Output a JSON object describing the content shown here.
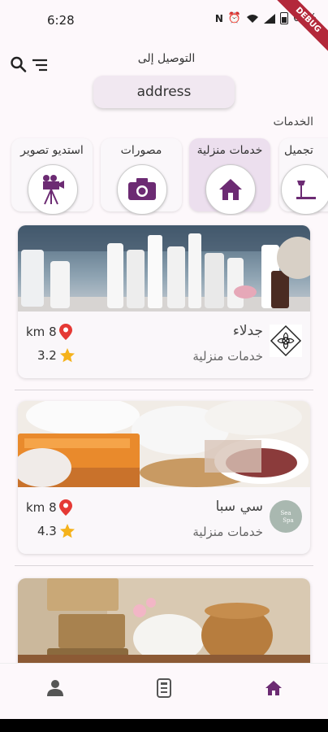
{
  "status": {
    "time": "6:28",
    "battery": "62%",
    "debug": "DEBUG"
  },
  "header": {
    "deliver_label": "التوصيل إلى",
    "address": "address"
  },
  "services_title": "الخدمات",
  "categories": [
    {
      "label": "تجميل",
      "icon": "beauty-icon",
      "active": false
    },
    {
      "label": "خدمات منزلية",
      "icon": "home-icon",
      "active": true
    },
    {
      "label": "مصورات",
      "icon": "camera-icon",
      "active": false
    },
    {
      "label": "استديو تصوير",
      "icon": "video-camera-tripod-icon",
      "active": false
    }
  ],
  "providers": [
    {
      "name": "جدلاء",
      "category": "خدمات منزلية",
      "distance": "km 8",
      "rating": "3.2"
    },
    {
      "name": "سي سبا",
      "category": "خدمات منزلية",
      "distance": "km 8",
      "rating": "4.3",
      "logo_text": "Sea Spa"
    },
    {
      "name": "",
      "category": "",
      "distance": "",
      "rating": ""
    }
  ],
  "nav": [
    {
      "icon": "profile-icon",
      "active": false
    },
    {
      "icon": "orders-icon",
      "active": false
    },
    {
      "icon": "home-icon",
      "active": true
    }
  ],
  "colors": {
    "accent": "#6c2b73",
    "pin": "#e53935",
    "star": "#f5b21b",
    "background": "#fdf8fb"
  }
}
